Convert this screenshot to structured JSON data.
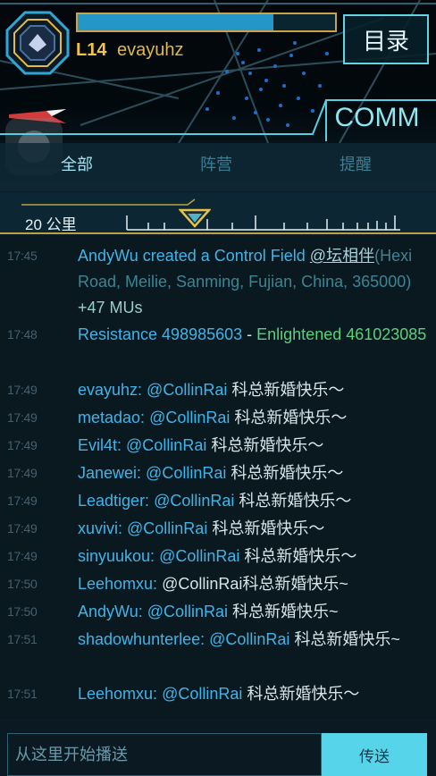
{
  "header": {
    "level": "L14",
    "agent": "evayuhz",
    "xp_progress": 0.76,
    "index_label": "目录",
    "comm_label": "COMM"
  },
  "tabs": [
    {
      "label": "全部",
      "active": true
    },
    {
      "label": "阵营",
      "active": false
    },
    {
      "label": "提醒",
      "active": false
    }
  ],
  "range": {
    "label": "20 公里"
  },
  "messages": [
    {
      "time": "17:45",
      "parts": [
        {
          "t": "AndyWu created a Control Field ",
          "c": "agent-blue"
        },
        {
          "t": "@坛相伴",
          "c": "portal"
        },
        {
          "t": "(Hexi Road, Meilie, Sanming, Fujian, China, 365000)",
          "c": "faint"
        },
        {
          "t": " +47 MUs",
          "c": "mu"
        }
      ]
    },
    {
      "time": "17:48",
      "parts": [
        {
          "t": "Resistance 498985603",
          "c": "agent-blue"
        },
        {
          "t": " - ",
          "c": "mention-white"
        },
        {
          "t": "Enlightened 461023085",
          "c": "ok-green"
        }
      ]
    },
    {
      "time": "17:49",
      "parts": [
        {
          "t": "evayuhz: ",
          "c": "agent-blue"
        },
        {
          "t": "@CollinRai",
          "c": "mention"
        },
        {
          "t": " 科总新婚快乐～",
          "c": "mention-white"
        }
      ]
    },
    {
      "time": "17:49",
      "parts": [
        {
          "t": "metadao: ",
          "c": "agent-blue"
        },
        {
          "t": "@CollinRai",
          "c": "mention"
        },
        {
          "t": " 科总新婚快乐～",
          "c": "mention-white"
        }
      ]
    },
    {
      "time": "17:49",
      "parts": [
        {
          "t": "Evil4t: ",
          "c": "agent-blue"
        },
        {
          "t": "@CollinRai",
          "c": "mention"
        },
        {
          "t": " 科总新婚快乐～",
          "c": "mention-white"
        }
      ]
    },
    {
      "time": "17:49",
      "parts": [
        {
          "t": "Janewei: ",
          "c": "agent-blue"
        },
        {
          "t": "@CollinRai",
          "c": "mention"
        },
        {
          "t": " 科总新婚快乐～",
          "c": "mention-white"
        }
      ]
    },
    {
      "time": "17:49",
      "parts": [
        {
          "t": "Leadtiger: ",
          "c": "agent-blue"
        },
        {
          "t": "@CollinRai",
          "c": "mention"
        },
        {
          "t": " 科总新婚快乐～",
          "c": "mention-white"
        }
      ]
    },
    {
      "time": "17:49",
      "parts": [
        {
          "t": "xuvivi: ",
          "c": "agent-blue"
        },
        {
          "t": "@CollinRai",
          "c": "mention"
        },
        {
          "t": " 科总新婚快乐～",
          "c": "mention-white"
        }
      ]
    },
    {
      "time": "17:49",
      "parts": [
        {
          "t": "sinyuukou: ",
          "c": "agent-blue"
        },
        {
          "t": "@CollinRai",
          "c": "mention"
        },
        {
          "t": " 科总新婚快乐～",
          "c": "mention-white"
        }
      ]
    },
    {
      "time": "17:50",
      "parts": [
        {
          "t": "Leehomxu: ",
          "c": "agent-blue"
        },
        {
          "t": "@CollinRai科总新婚快乐~",
          "c": "mention-white"
        }
      ]
    },
    {
      "time": "17:50",
      "parts": [
        {
          "t": "AndyWu: ",
          "c": "agent-blue"
        },
        {
          "t": "@CollinRai",
          "c": "mention"
        },
        {
          "t": " 科总新婚快乐~",
          "c": "mention-white"
        }
      ]
    },
    {
      "time": "17:51",
      "parts": [
        {
          "t": "shadowhunterlee: ",
          "c": "agent-blue"
        },
        {
          "t": "@CollinRai",
          "c": "mention"
        },
        {
          "t": " 科总新婚快乐~",
          "c": "mention-white"
        }
      ]
    },
    {
      "time": "17:51",
      "parts": [
        {
          "t": "Leehomxu: ",
          "c": "agent-blue"
        },
        {
          "t": "@CollinRai",
          "c": "mention"
        },
        {
          "t": "  科总新婚快乐～",
          "c": "mention-white"
        }
      ]
    }
  ],
  "input": {
    "placeholder": "从这里开始播送",
    "value": "",
    "send_label": "传送"
  }
}
